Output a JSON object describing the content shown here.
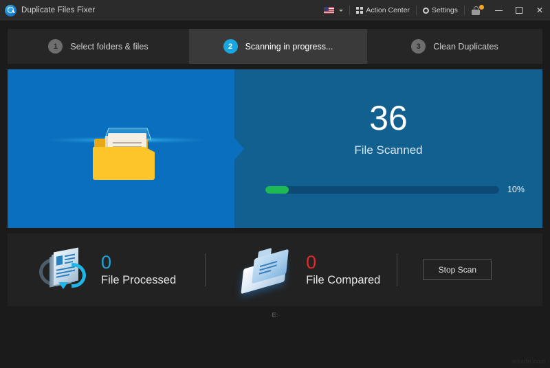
{
  "window": {
    "title": "Duplicate Files Fixer",
    "logo_icon": "magnifier-circle-icon",
    "toolbar": {
      "language_icon": "us-flag-icon",
      "language_chevron": "chevron-down-icon",
      "action_center_label": "Action Center",
      "action_center_icon": "grid-icon",
      "settings_label": "Settings",
      "settings_icon": "gear-icon",
      "lock_icon": "lock-icon",
      "lock_badge_color": "#f5a623"
    },
    "controls": {
      "minimize": "minimize-icon",
      "maximize": "maximize-icon",
      "close": "✕"
    }
  },
  "steps": [
    {
      "number": "1",
      "label": "Select folders & files",
      "active": false
    },
    {
      "number": "2",
      "label": "Scanning in progress...",
      "active": true
    },
    {
      "number": "3",
      "label": "Clean Duplicates",
      "active": false
    }
  ],
  "hero": {
    "illustration_icon": "folder-scanning-icon",
    "count": "36",
    "count_label": "File Scanned",
    "progress_percent_label": "10%",
    "progress_percent_value": 10,
    "progress_fill_color": "#1db954",
    "progress_track_color": "#0c4a73",
    "panel_left_color": "#0b6fc0",
    "panel_right_color": "#12608f"
  },
  "stats": {
    "processed": {
      "icon": "document-refresh-icon",
      "value": "0",
      "label": "File Processed",
      "value_color": "#1da4da"
    },
    "compared": {
      "icon": "compare-documents-icon",
      "value": "0",
      "label": "File Compared",
      "value_color": "#e02b2b"
    },
    "stop_button_label": "Stop Scan"
  },
  "footer": {
    "current_path": "E:",
    "watermark": "wsxdn.com"
  }
}
